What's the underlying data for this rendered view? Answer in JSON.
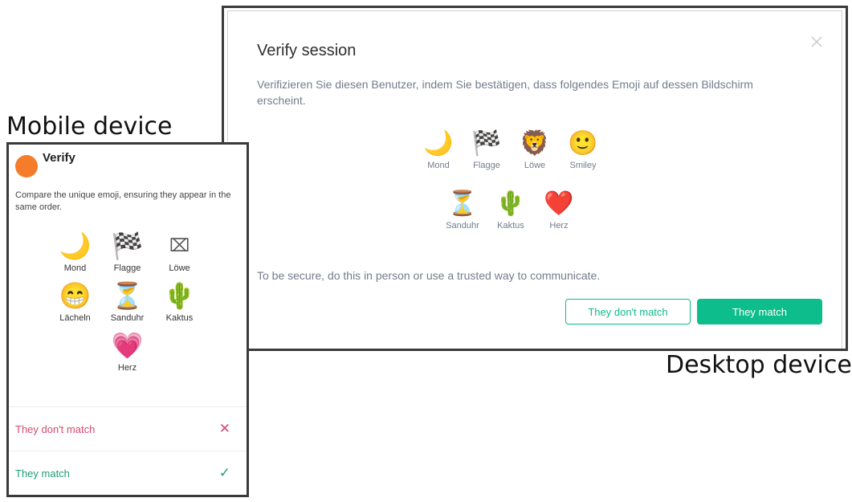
{
  "captions": {
    "mobile": "Mobile device",
    "desktop": "Desktop device"
  },
  "desktop": {
    "title": "Verify session",
    "close_icon": "close-icon",
    "description": "Verifizieren Sie diesen Benutzer, indem Sie bestätigen, dass folgendes Emoji auf dessen Bildschirm erscheint.",
    "emoji_rows": [
      [
        {
          "glyph": "🌙",
          "label": "Mond"
        },
        {
          "glyph": "🏁",
          "label": "Flagge"
        },
        {
          "glyph": "🦁",
          "label": "Löwe"
        },
        {
          "glyph": "🙂",
          "label": "Smiley"
        }
      ],
      [
        {
          "glyph": "⏳",
          "label": "Sanduhr"
        },
        {
          "glyph": "🌵",
          "label": "Kaktus"
        },
        {
          "glyph": "❤️",
          "label": "Herz"
        }
      ]
    ],
    "secure_note": "To be secure, do this in person or use a trusted way to communicate.",
    "buttons": {
      "no_match": "They don't match",
      "match": "They match"
    },
    "colors": {
      "accent": "#0dbd8b"
    }
  },
  "mobile": {
    "title": "Verify",
    "avatar_color": "#f47c2b",
    "description": "Compare the unique emoji, ensuring they appear in the same order.",
    "emojis": [
      {
        "glyph": "🌙",
        "label": "Mond"
      },
      {
        "glyph": "🏁",
        "label": "Flagge"
      },
      {
        "glyph": "⌧",
        "label": "Löwe"
      },
      {
        "glyph": "😁",
        "label": "Lächeln"
      },
      {
        "glyph": "⏳",
        "label": "Sanduhr"
      },
      {
        "glyph": "🌵",
        "label": "Kaktus"
      },
      {
        "glyph": "💗",
        "label": "Herz"
      }
    ],
    "actions": {
      "no_match": "They don't match",
      "no_match_icon": "✕",
      "match": "They match",
      "match_icon": "✓"
    },
    "colors": {
      "no_match": "#d44a6f",
      "match": "#1e9e74"
    }
  }
}
